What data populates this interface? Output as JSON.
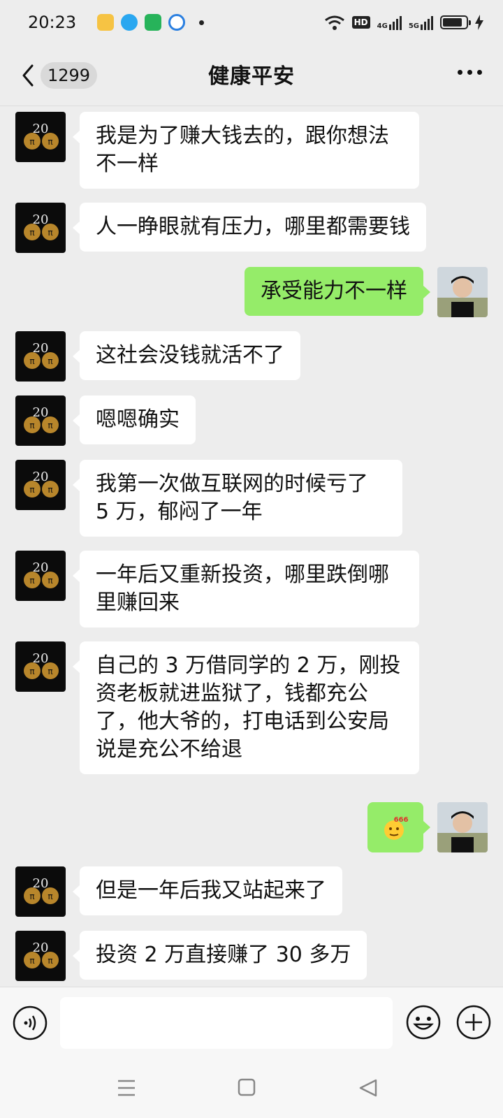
{
  "status_bar": {
    "time": "20:23",
    "network_label_1": "4G",
    "network_label_2": "5G",
    "hd_label": "HD"
  },
  "header": {
    "back_icon": "chevron-left-icon",
    "unread_count": "1299",
    "title": "健康平安",
    "more_icon": "more-dots-icon"
  },
  "messages": [
    {
      "side": "left",
      "text": "我是为了赚大钱去的，跟你想法不一样"
    },
    {
      "side": "left",
      "text": "人一睁眼就有压力，哪里都需要钱"
    },
    {
      "side": "right",
      "text": "承受能力不一样"
    },
    {
      "side": "left",
      "text": "这社会没钱就活不了"
    },
    {
      "side": "left",
      "text": "嗯嗯确实"
    },
    {
      "side": "left",
      "text": "我第一次做互联网的时候亏了 5 万，郁闷了一年"
    },
    {
      "side": "left",
      "text": "一年后又重新投资，哪里跌倒哪里赚回来"
    },
    {
      "side": "left",
      "text": "自己的 3 万借同学的 2 万，刚投资老板就进监狱了，钱都充公了，他大爷的，打电话到公安局说是充公不给退"
    },
    {
      "side": "right",
      "sticker": "666-emoji-sticker",
      "text": "666"
    },
    {
      "side": "left",
      "text": "但是一年后我又站起来了"
    },
    {
      "side": "left",
      "text": "投资 2 万直接赚了 30 多万"
    }
  ],
  "input_bar": {
    "placeholder": "",
    "voice_icon": "voice-icon",
    "emoji_icon": "emoji-icon",
    "plus_icon": "plus-icon"
  },
  "nav_bar": {
    "menu_icon": "menu-icon",
    "home_icon": "home-icon",
    "back_icon": "back-triangle-icon"
  },
  "colors": {
    "background": "#ededed",
    "bubble_self": "#95ec69",
    "bubble_other": "#ffffff"
  }
}
